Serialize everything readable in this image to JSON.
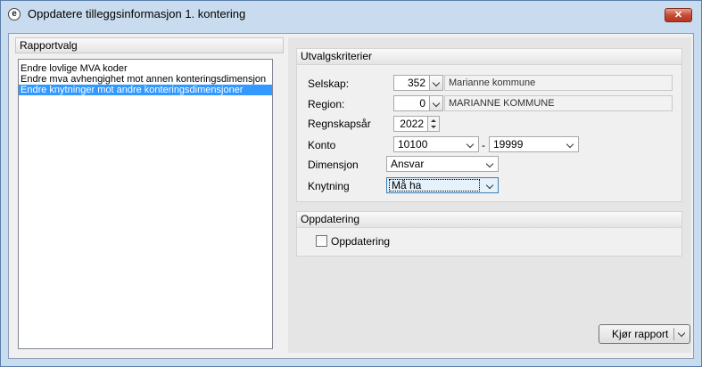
{
  "window": {
    "title": "Oppdatere tilleggsinformasjon 1. kontering",
    "app_icon": "e",
    "close_glyph": "✕"
  },
  "rapportvalg": {
    "header": "Rapportvalg",
    "items": [
      "Endre lovlige MVA koder",
      "Endre mva avhengighet mot annen konteringsdimensjon",
      "Endre knytninger mot andre konteringsdimensjoner"
    ],
    "selected_index": 2
  },
  "utvalg": {
    "header": "Utvalgskriterier",
    "selskap": {
      "label": "Selskap:",
      "value": "352",
      "name": "Marianne kommune"
    },
    "region": {
      "label": "Region:",
      "value": "0",
      "name": "MARIANNE KOMMUNE"
    },
    "regnskapsar": {
      "label": "Regnskapsår",
      "value": "2022"
    },
    "konto": {
      "label": "Konto",
      "from": "10100",
      "separator": "-",
      "to": "19999"
    },
    "dimensjon": {
      "label": "Dimensjon",
      "value": "Ansvar"
    },
    "knytning": {
      "label": "Knytning",
      "value": "Må ha"
    }
  },
  "oppdatering": {
    "header": "Oppdatering",
    "checkbox_label": "Oppdatering",
    "checked": false
  },
  "run_button": {
    "label": "Kjør rapport"
  },
  "colors": {
    "selection": "#3399ff",
    "close_button": "#c94a33",
    "frame": "#c9dcef"
  }
}
